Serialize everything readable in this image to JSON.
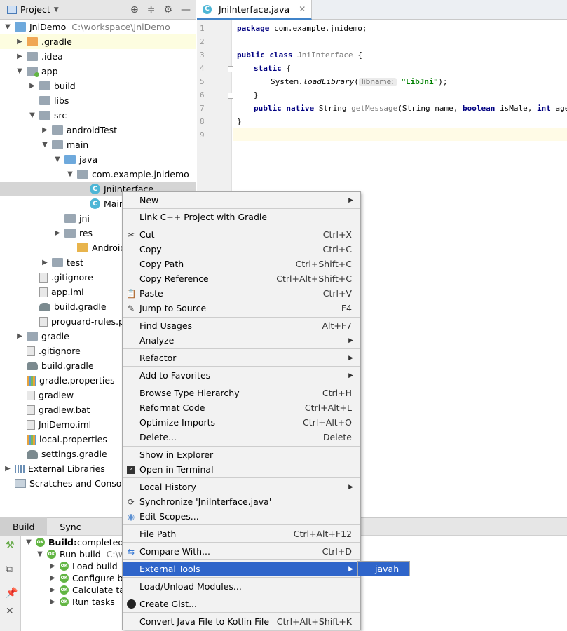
{
  "project_panel": {
    "title": "Project",
    "tree": [
      {
        "label": "JniDemo",
        "path": "C:\\workspace\\JniDemo",
        "icon": "module-folder-icon",
        "arrow": "▼"
      },
      {
        "label": ".gradle",
        "icon": "folder-orange-icon",
        "arrow": "▶"
      },
      {
        "label": ".idea",
        "icon": "folder-icon",
        "arrow": "▶"
      },
      {
        "label": "app",
        "icon": "module-folder-icon",
        "arrow": "▼"
      },
      {
        "label": "build",
        "icon": "folder-icon",
        "arrow": "▶"
      },
      {
        "label": "libs",
        "icon": "folder-icon",
        "arrow": ""
      },
      {
        "label": "src",
        "icon": "folder-icon",
        "arrow": "▼"
      },
      {
        "label": "androidTest",
        "icon": "folder-icon",
        "arrow": "▶"
      },
      {
        "label": "main",
        "icon": "folder-icon",
        "arrow": "▼"
      },
      {
        "label": "java",
        "icon": "source-folder-icon",
        "arrow": "▼"
      },
      {
        "label": "com.example.jnidemo",
        "icon": "package-icon",
        "arrow": "▼"
      },
      {
        "label": "JniInterface",
        "icon": "class-icon",
        "arrow": ""
      },
      {
        "label": "Main",
        "icon": "class-icon",
        "arrow": ""
      },
      {
        "label": "jni",
        "icon": "folder-icon",
        "arrow": ""
      },
      {
        "label": "res",
        "icon": "resource-folder-icon",
        "arrow": "▶"
      },
      {
        "label": "AndroidMa",
        "icon": "manifest-icon",
        "arrow": ""
      },
      {
        "label": "test",
        "icon": "folder-icon",
        "arrow": "▶"
      },
      {
        "label": ".gitignore",
        "icon": "file-icon",
        "arrow": ""
      },
      {
        "label": "app.iml",
        "icon": "file-icon",
        "arrow": ""
      },
      {
        "label": "build.gradle",
        "icon": "gradle-icon",
        "arrow": ""
      },
      {
        "label": "proguard-rules.p",
        "icon": "file-icon",
        "arrow": ""
      },
      {
        "label": "gradle",
        "icon": "folder-icon",
        "arrow": "▶"
      },
      {
        "label": ".gitignore",
        "icon": "file-icon",
        "arrow": ""
      },
      {
        "label": "build.gradle",
        "icon": "gradle-icon",
        "arrow": ""
      },
      {
        "label": "gradle.properties",
        "icon": "properties-icon",
        "arrow": ""
      },
      {
        "label": "gradlew",
        "icon": "file-icon",
        "arrow": ""
      },
      {
        "label": "gradlew.bat",
        "icon": "file-icon",
        "arrow": ""
      },
      {
        "label": "JniDemo.iml",
        "icon": "file-icon",
        "arrow": ""
      },
      {
        "label": "local.properties",
        "icon": "properties-icon",
        "arrow": ""
      },
      {
        "label": "settings.gradle",
        "icon": "gradle-icon",
        "arrow": ""
      },
      {
        "label": "External Libraries",
        "icon": "library-icon",
        "arrow": "▶"
      },
      {
        "label": "Scratches and Console",
        "icon": "scratches-icon",
        "arrow": ""
      }
    ]
  },
  "editor": {
    "tab_label": "JniInterface.java",
    "line_numbers": [
      "1",
      "2",
      "3",
      "4",
      "5",
      "6",
      "7",
      "8",
      "9"
    ],
    "code": {
      "l1_kw": "package",
      "l1_rest": " com.example.jnidemo;",
      "l3_kw": "public class",
      "l3_name": " JniInterface",
      "l3_rest": " {",
      "l4_kw": "static",
      "l4_rest": " {",
      "l5_obj": "System.",
      "l5_fn": "loadLibrary",
      "l5_paren": "(",
      "l5_hint": "libname:",
      "l5_str": "\"LibJni\"",
      "l5_end": ");",
      "l6": "}",
      "l7_kw": "public native",
      "l7_type": " String ",
      "l7_fn": "getMessage",
      "l7_a": "(String name, ",
      "l7_kw2": "boolean",
      "l7_b": " isMale, ",
      "l7_kw3": "int",
      "l7_c": " age);",
      "l8": "}"
    }
  },
  "context_menu": {
    "items": [
      {
        "label": "New",
        "shortcut": "",
        "submenu": true,
        "icon": ""
      },
      {
        "label": "Link C++ Project with Gradle",
        "shortcut": "",
        "submenu": false,
        "icon": ""
      },
      {
        "label": "Cut",
        "shortcut": "Ctrl+X",
        "submenu": false,
        "icon": "cut-icon"
      },
      {
        "label": "Copy",
        "shortcut": "Ctrl+C",
        "submenu": false,
        "icon": ""
      },
      {
        "label": "Copy Path",
        "shortcut": "Ctrl+Shift+C",
        "submenu": false,
        "icon": ""
      },
      {
        "label": "Copy Reference",
        "shortcut": "Ctrl+Alt+Shift+C",
        "submenu": false,
        "icon": ""
      },
      {
        "label": "Paste",
        "shortcut": "Ctrl+V",
        "submenu": false,
        "icon": "paste-icon"
      },
      {
        "label": "Jump to Source",
        "shortcut": "F4",
        "submenu": false,
        "icon": "edit-icon"
      },
      {
        "label": "Find Usages",
        "shortcut": "Alt+F7",
        "submenu": false,
        "icon": ""
      },
      {
        "label": "Analyze",
        "shortcut": "",
        "submenu": true,
        "icon": ""
      },
      {
        "label": "Refactor",
        "shortcut": "",
        "submenu": true,
        "icon": ""
      },
      {
        "label": "Add to Favorites",
        "shortcut": "",
        "submenu": true,
        "icon": ""
      },
      {
        "label": "Browse Type Hierarchy",
        "shortcut": "Ctrl+H",
        "submenu": false,
        "icon": ""
      },
      {
        "label": "Reformat Code",
        "shortcut": "Ctrl+Alt+L",
        "submenu": false,
        "icon": ""
      },
      {
        "label": "Optimize Imports",
        "shortcut": "Ctrl+Alt+O",
        "submenu": false,
        "icon": ""
      },
      {
        "label": "Delete...",
        "shortcut": "Delete",
        "submenu": false,
        "icon": ""
      },
      {
        "label": "Show in Explorer",
        "shortcut": "",
        "submenu": false,
        "icon": ""
      },
      {
        "label": "Open in Terminal",
        "shortcut": "",
        "submenu": false,
        "icon": "terminal-icon"
      },
      {
        "label": "Local History",
        "shortcut": "",
        "submenu": true,
        "icon": ""
      },
      {
        "label": "Synchronize 'JniInterface.java'",
        "shortcut": "",
        "submenu": false,
        "icon": "sync-icon"
      },
      {
        "label": "Edit Scopes...",
        "shortcut": "",
        "submenu": false,
        "icon": "scope-icon"
      },
      {
        "label": "File Path",
        "shortcut": "Ctrl+Alt+F12",
        "submenu": false,
        "icon": ""
      },
      {
        "label": "Compare With...",
        "shortcut": "Ctrl+D",
        "submenu": false,
        "icon": "compare-icon"
      },
      {
        "label": "External Tools",
        "shortcut": "",
        "submenu": true,
        "icon": "",
        "active": true
      },
      {
        "label": "Load/Unload Modules...",
        "shortcut": "",
        "submenu": false,
        "icon": ""
      },
      {
        "label": "Create Gist...",
        "shortcut": "",
        "submenu": false,
        "icon": "github-icon"
      },
      {
        "label": "Convert Java File to Kotlin File",
        "shortcut": "Ctrl+Alt+Shift+K",
        "submenu": false,
        "icon": ""
      }
    ],
    "submenu_item": "javah"
  },
  "build_panel": {
    "tabs": [
      "Build",
      "Sync"
    ],
    "rows": [
      {
        "bold": "Build:",
        "text": " completed",
        "arrow": "▼"
      },
      {
        "bold": "",
        "text": "Run build",
        "muted": "C:\\w",
        "arrow": "▼"
      },
      {
        "bold": "",
        "text": "Load build",
        "arrow": "▶"
      },
      {
        "bold": "",
        "text": "Configure b",
        "arrow": "▶"
      },
      {
        "bold": "",
        "text": "Calculate ta",
        "arrow": "▶"
      },
      {
        "bold": "",
        "text": "Run tasks",
        "arrow": "▶"
      }
    ]
  },
  "colors": {
    "menu_highlight": "#2f65ca",
    "selected_row": "#d5d5d5",
    "keyword": "#000080",
    "string": "#008000"
  }
}
